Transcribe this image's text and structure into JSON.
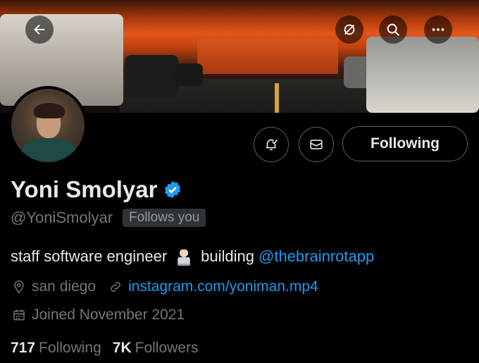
{
  "banner": {
    "description_color": "#e2571a"
  },
  "nav": {
    "back_icon": "back-arrow-icon",
    "grok_icon": "grok-icon",
    "search_icon": "search-icon",
    "more_icon": "more-icon"
  },
  "actions": {
    "notify_icon": "bell-check-icon",
    "message_icon": "envelope-icon",
    "following_label": "Following"
  },
  "profile": {
    "name": "Yoni Smolyar",
    "verified_color": "#1d9bf0",
    "handle": "@YoniSmolyar",
    "follows_you": "Follows you",
    "bio_text": "staff software engineer",
    "bio_emoji": "technologist-emoji",
    "bio_building": "building",
    "bio_link": "@thebrainrotapp",
    "location": "san diego",
    "website": "instagram.com/yoniman.mp4",
    "joined": "Joined November 2021"
  },
  "stats": {
    "following_count": "717",
    "following_label": "Following",
    "followers_count": "7K",
    "followers_label": "Followers"
  },
  "colors": {
    "accent": "#1d9bf0",
    "muted": "#71767b",
    "text": "#e7e9ea",
    "border": "#536471"
  }
}
